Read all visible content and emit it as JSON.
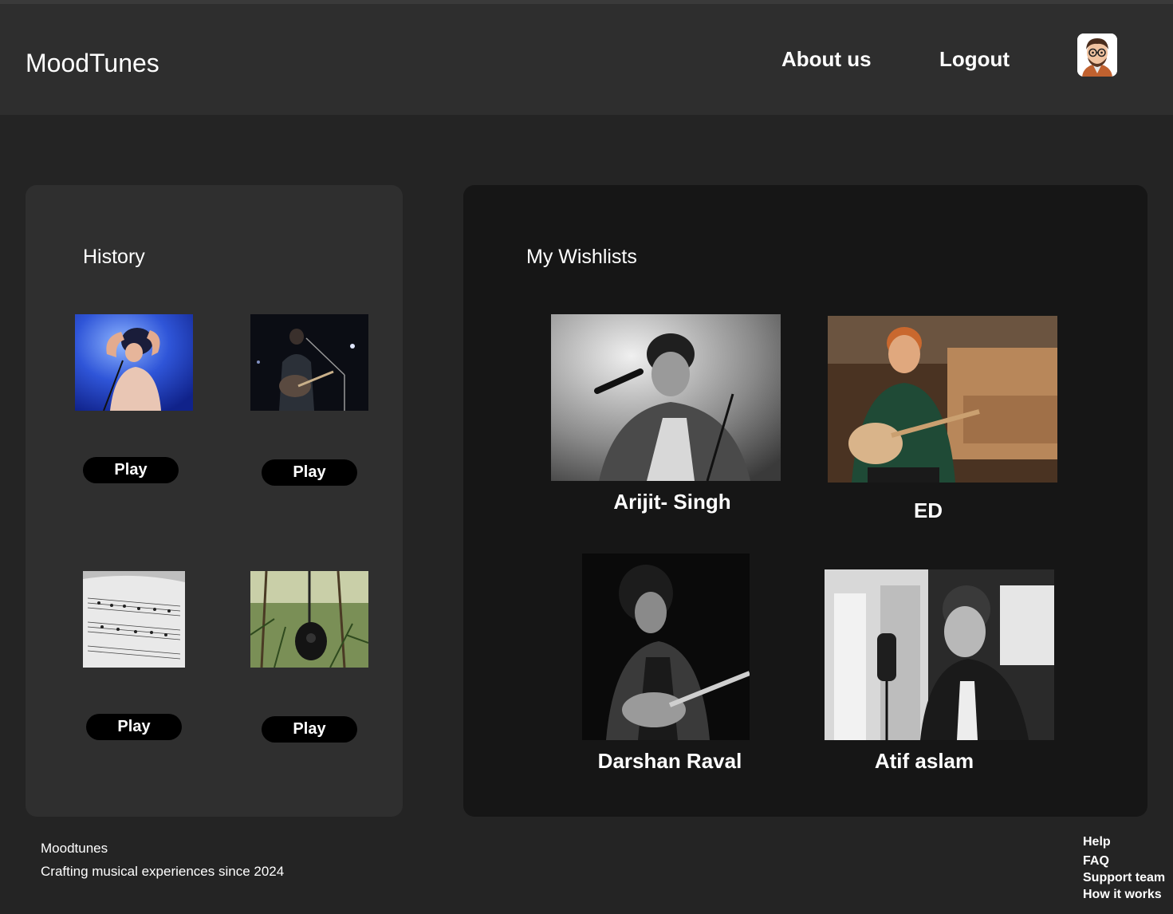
{
  "header": {
    "brand": "MoodTunes",
    "nav": {
      "about": "About us",
      "logout": "Logout"
    },
    "avatar_icon": "avatar-icon"
  },
  "history": {
    "title": "History",
    "items": [
      {
        "image": "singer-blue-stage-image",
        "play_label": "Play"
      },
      {
        "image": "guitarist-dark-stage-image",
        "play_label": "Play"
      },
      {
        "image": "sheet-music-image",
        "play_label": "Play"
      },
      {
        "image": "guitar-in-grass-image",
        "play_label": "Play"
      }
    ]
  },
  "wishlists": {
    "title": "My Wishlists",
    "artists": [
      {
        "name": "Arijit- Singh"
      },
      {
        "name": "ED"
      },
      {
        "name": "Darshan Raval"
      },
      {
        "name": "Atif aslam"
      }
    ]
  },
  "footer": {
    "left": {
      "brand": "Moodtunes",
      "tagline": "Crafting musical experiences since 2024"
    },
    "links": {
      "help": "Help",
      "faq": "FAQ",
      "support": "Support team",
      "how": "How it works"
    }
  },
  "colors": {
    "background": "#242424",
    "header": "#2e2e2e",
    "history_panel": "#2f2f2f",
    "wishlist_panel": "#161616",
    "button": "#000000"
  }
}
